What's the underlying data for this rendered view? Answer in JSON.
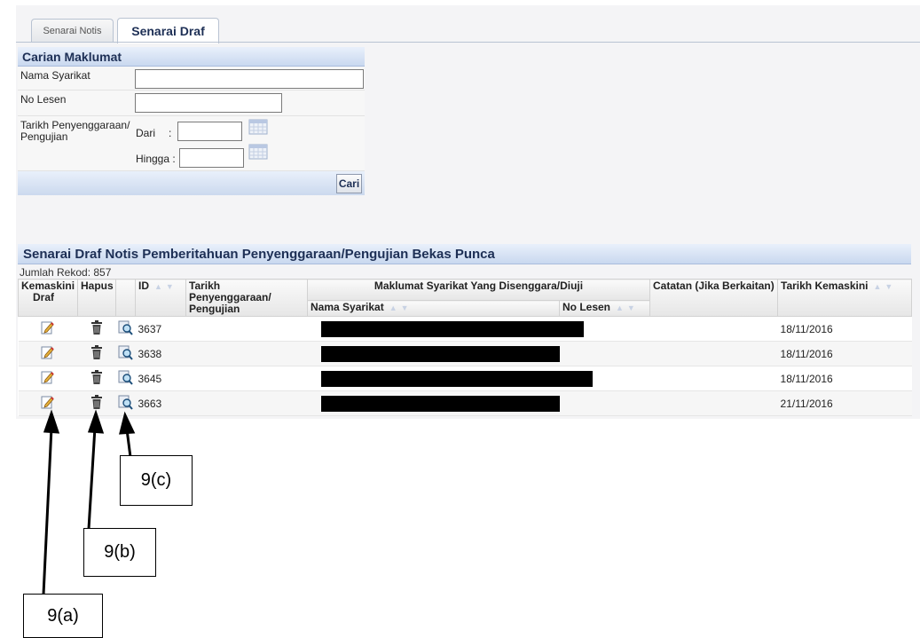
{
  "tabs": [
    {
      "label": "Senarai Notis",
      "active": false
    },
    {
      "label": "Senarai Draf",
      "active": true
    }
  ],
  "search": {
    "title": "Carian Maklumat",
    "company_label": "Nama Syarikat",
    "company_value": "",
    "license_label": "No Lesen",
    "license_value": "",
    "date_label_line1": "Tarikh Penyenggaraan/",
    "date_label_line2": "Pengujian",
    "from_label": "Dari",
    "from_colon": ":",
    "to_label": "Hingga :",
    "button_label": "Cari"
  },
  "list": {
    "title": "Senarai Draf Notis Pemberitahuan Penyenggaraan/Pengujian Bekas Punca",
    "record_count": "Jumlah Rekod: 857",
    "headers": {
      "edit_line1": "Kemaskini",
      "edit_line2": "Draf",
      "delete": "Hapus",
      "id": "ID",
      "date_line1": "Tarikh Penyenggaraan/",
      "date_line2": "Pengujian",
      "company_group": "Maklumat Syarikat Yang Disenggara/Diuji",
      "company_name": "Nama Syarikat",
      "license_no": "No Lesen",
      "notes": "Catatan (Jika Berkaitan)",
      "updated": "Tarikh Kemaskini"
    },
    "rows": [
      {
        "id": "3637",
        "updated": "18/11/2016"
      },
      {
        "id": "3638",
        "updated": "18/11/2016"
      },
      {
        "id": "3645",
        "updated": "18/11/2016"
      },
      {
        "id": "3663",
        "updated": "21/11/2016"
      }
    ]
  },
  "callouts": {
    "a": "9(a)",
    "b": "9(b)",
    "c": "9(c)"
  },
  "icons": {
    "edit": "pencil-edit-icon",
    "delete": "trash-icon",
    "view": "magnifier-view-icon",
    "calendar": "calendar-icon"
  },
  "colors": {
    "header_text": "#1d2f55",
    "panel_header_bg": "#c9d8ef",
    "redaction": "#000000"
  }
}
